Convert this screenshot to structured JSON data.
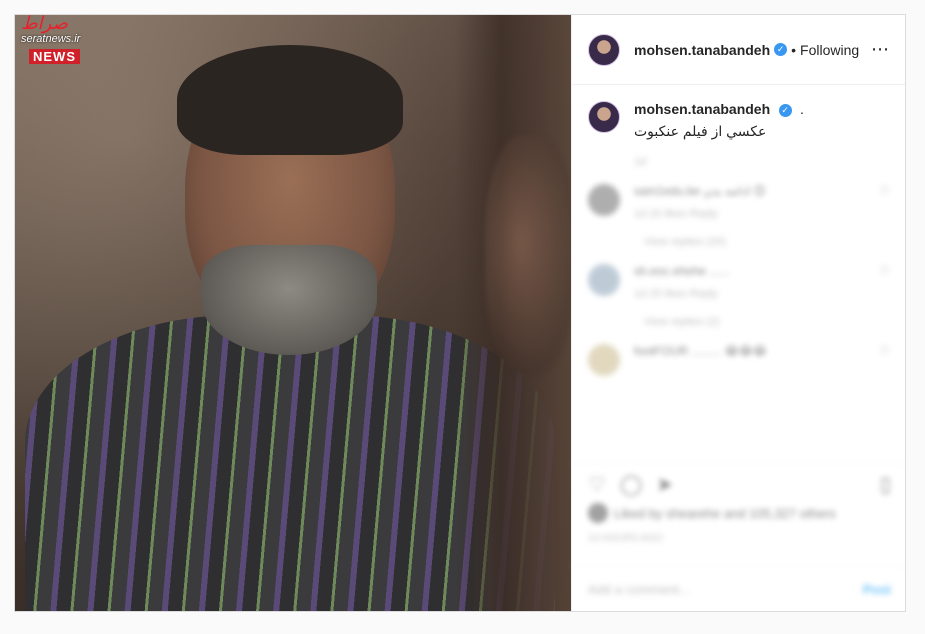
{
  "watermark": {
    "script": "صراط",
    "site": "seratnews.ir",
    "brand": "NEWS"
  },
  "header": {
    "username": "mohsen.tanabandeh",
    "separator": "•",
    "follow_status": "Following",
    "more_icon": "⋯"
  },
  "caption": {
    "username": "mohsen.tanabandeh",
    "punct": ".",
    "text": "عكسي از فيلم عنكبوت"
  },
  "blurred": {
    "age": "1d",
    "comments": [
      {
        "line": "sam1edu.be ادامه بدن 😊",
        "meta": "1d  20 likes  Reply",
        "replies": "View replies (20)"
      },
      {
        "line": "sh.eoc.ehehe ......",
        "meta": "1d  25 likes  Reply",
        "replies": "View replies (2)"
      },
      {
        "line": "footFOUR ......... 😂😂😂",
        "meta": "",
        "replies": ""
      }
    ],
    "likes": "Liked by shearehe and 105,327 others",
    "posted": "13 HOURS AGO",
    "add_comment_placeholder": "Add a comment...",
    "post_button": "Post"
  },
  "icons": {
    "verified": "verified-badge",
    "heart": "heart-icon",
    "comment": "comment-icon",
    "share": "share-icon",
    "save": "bookmark-icon"
  },
  "colors": {
    "accent": "#3897f0",
    "watermark_red": "#d0202a",
    "link_blue": "#0095f6"
  }
}
